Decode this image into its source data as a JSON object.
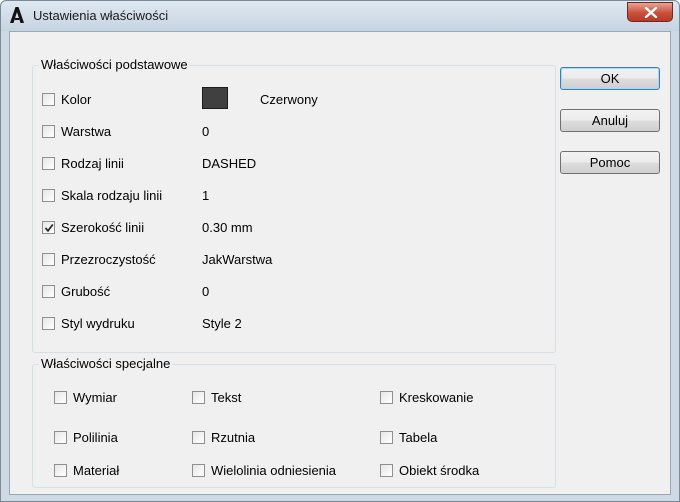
{
  "window": {
    "title": "Ustawienia właściwości"
  },
  "basic": {
    "legend": "Właściwości podstawowe",
    "rows": [
      {
        "label": "Kolor",
        "checked": false,
        "value": "Czerwony",
        "swatch_color": "#404040"
      },
      {
        "label": "Warstwa",
        "checked": false,
        "value": "0"
      },
      {
        "label": "Rodzaj linii",
        "checked": false,
        "value": "DASHED"
      },
      {
        "label": "Skala rodzaju linii",
        "checked": false,
        "value": "1"
      },
      {
        "label": "Szerokość linii",
        "checked": true,
        "value": "0.30 mm"
      },
      {
        "label": "Przezroczystość",
        "checked": false,
        "value": "JakWarstwa"
      },
      {
        "label": "Grubość",
        "checked": false,
        "value": "0"
      },
      {
        "label": "Styl wydruku",
        "checked": false,
        "value": "Style 2"
      }
    ]
  },
  "special": {
    "legend": "Właściwości specjalne",
    "items": [
      {
        "label": "Wymiar",
        "checked": false
      },
      {
        "label": "Tekst",
        "checked": false
      },
      {
        "label": "Kreskowanie",
        "checked": false
      },
      {
        "label": "Polilinia",
        "checked": false
      },
      {
        "label": "Rzutnia",
        "checked": false
      },
      {
        "label": "Tabela",
        "checked": false
      },
      {
        "label": "Materiał",
        "checked": false
      },
      {
        "label": "Wielolinia odniesienia",
        "checked": false
      },
      {
        "label": "Obiekt środka",
        "checked": false
      }
    ]
  },
  "buttons": {
    "ok": "OK",
    "cancel": "Anuluj",
    "help": "Pomoc"
  }
}
